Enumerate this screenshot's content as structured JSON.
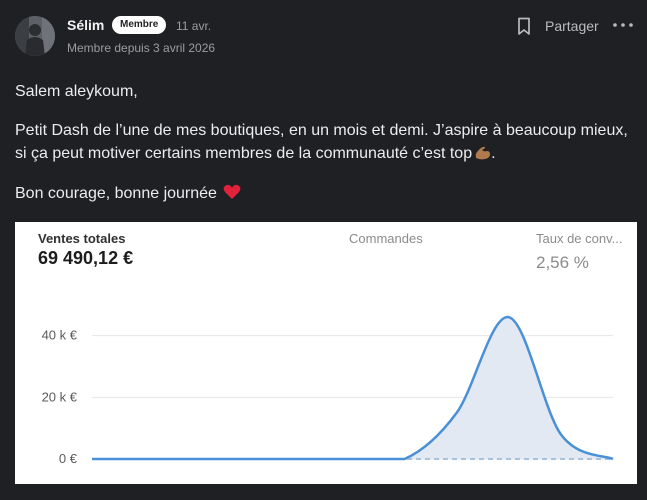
{
  "post": {
    "author": "Sélim",
    "badge": "Membre",
    "date": "11 avr.",
    "member_since": "Membre depuis 3 avril 2026",
    "share_label": "Partager",
    "greeting": "Salem aleykoum,",
    "paragraph": "Petit Dash de l’une de mes boutiques, en un mois et demi. J’aspire à beaucoup mieux, si ça peut motiver certains membres de la communauté c’est top",
    "paragraph_end": ".",
    "closing": "Bon courage, bonne journée",
    "icons": {
      "avatar": "user-avatar-photo",
      "bookmark": "bookmark-icon",
      "more": "more-horizontal-icon",
      "flex": "flexed-biceps-emoji",
      "heart": "red-heart-emoji"
    }
  },
  "dashboard": {
    "metrics": [
      {
        "label": "Ventes totales",
        "value": "69 490,12 €"
      },
      {
        "label": "Commandes",
        "value": ""
      },
      {
        "label": "Taux de conv...",
        "value": "2,56 %"
      }
    ]
  },
  "chart_data": {
    "type": "area",
    "title": "",
    "xlabel": "",
    "ylabel": "",
    "y_ticks": [
      {
        "value": 0,
        "label": "0 €"
      },
      {
        "value": 20000,
        "label": "20 k €"
      },
      {
        "value": 40000,
        "label": "40 k €"
      }
    ],
    "ylim": [
      0,
      48000
    ],
    "x_count": 11,
    "series": [
      {
        "values": [
          0,
          0,
          0,
          0,
          0,
          0,
          0,
          15000,
          46000,
          8000,
          0
        ],
        "color": "#4a90d6"
      }
    ],
    "comparison_dashed": true,
    "grid": true,
    "colors": {
      "line": "#4a90d6",
      "fill": "#e3e9f3",
      "grid": "#e6e6e6",
      "dashed": "#a9c2dc"
    }
  }
}
